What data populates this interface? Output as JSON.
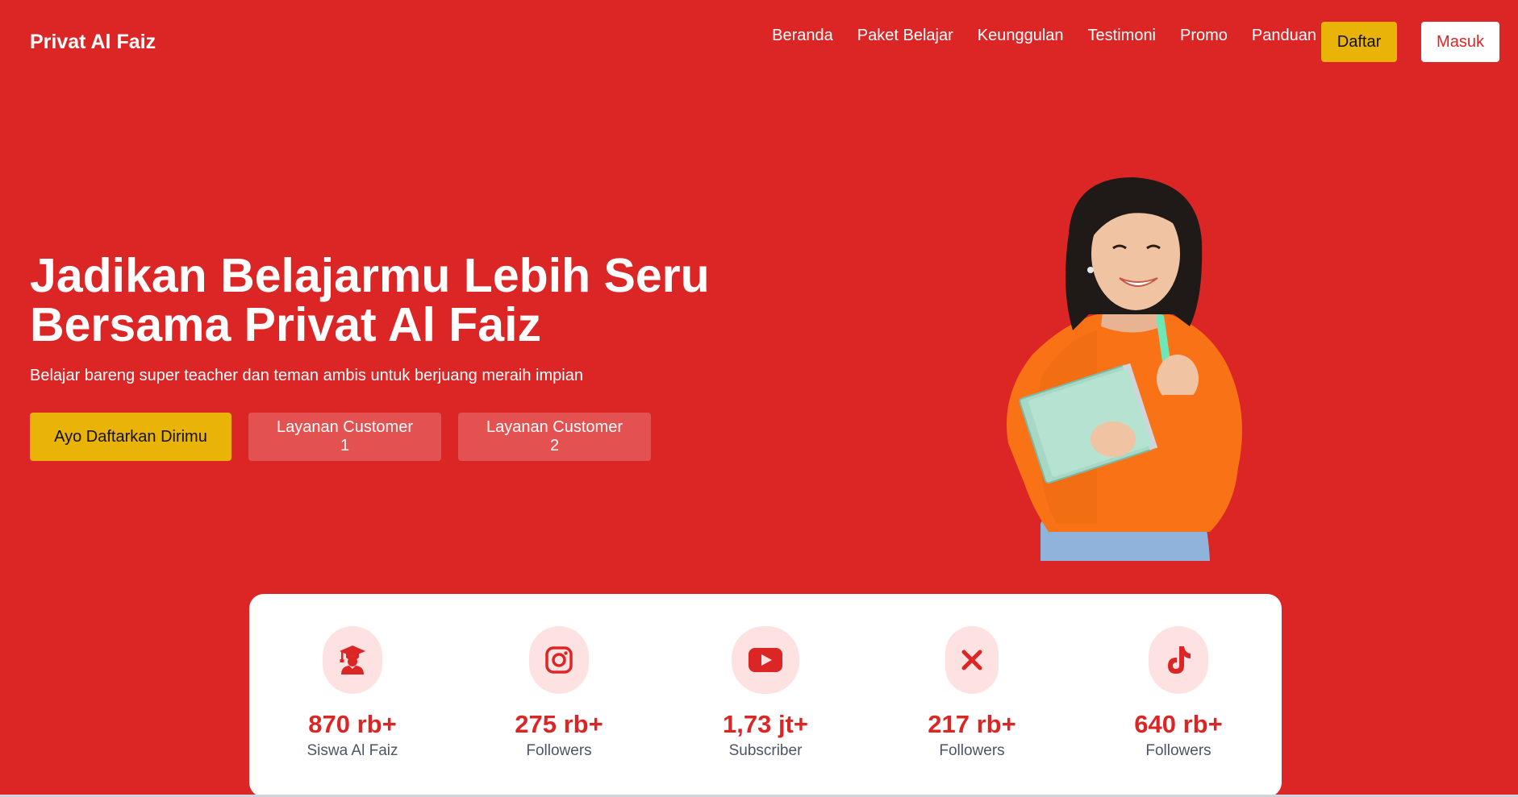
{
  "brand": "Privat Al Faiz",
  "nav": {
    "links": [
      "Beranda",
      "Paket Belajar",
      "Keunggulan",
      "Testimoni",
      "Promo",
      "Panduan"
    ],
    "daftar": "Daftar",
    "masuk": "Masuk"
  },
  "hero": {
    "title_line1": "Jadikan Belajarmu Lebih Seru",
    "title_line2": "Bersama Privat Al Faiz",
    "subtitle": "Belajar bareng super teacher dan teman ambis untuk berjuang meraih impian",
    "cta_primary": "Ayo Daftarkan Dirimu",
    "cta_cs1": "Layanan Customer 1",
    "cta_cs2": "Layanan Customer 2"
  },
  "stats": [
    {
      "icon": "graduate-icon",
      "value": "870 rb+",
      "label": "Siswa Al Faiz"
    },
    {
      "icon": "instagram-icon",
      "value": "275 rb+",
      "label": "Followers"
    },
    {
      "icon": "youtube-icon",
      "value": "1,73 jt+",
      "label": "Subscriber"
    },
    {
      "icon": "x-icon",
      "value": "217 rb+",
      "label": "Followers"
    },
    {
      "icon": "tiktok-icon",
      "value": "640 rb+",
      "label": "Followers"
    }
  ],
  "colors": {
    "primary": "#DC2626",
    "accent": "#EAB308",
    "icon_bg": "#FEE2E2"
  }
}
